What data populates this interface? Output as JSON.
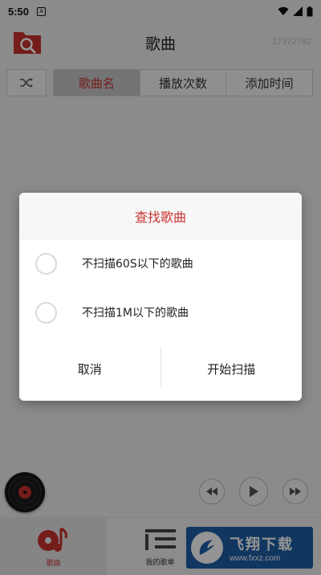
{
  "status_bar": {
    "time": "5:50",
    "notif_icon": "A"
  },
  "app_bar": {
    "title": "歌曲",
    "subtitle": "17372792",
    "logo_icon": "folder-search-icon"
  },
  "sort_tabs": [
    {
      "label": "歌曲名",
      "active": true
    },
    {
      "label": "播放次数",
      "active": false
    },
    {
      "label": "添加时间",
      "active": false
    }
  ],
  "dialog": {
    "title": "查找歌曲",
    "options": [
      {
        "label": "不扫描60S以下的歌曲",
        "checked": false
      },
      {
        "label": "不扫描1M以下的歌曲",
        "checked": false
      }
    ],
    "cancel_label": "取消",
    "confirm_label": "开始扫描"
  },
  "bottom_nav": {
    "items": [
      {
        "label": "歌曲",
        "icon": "music-note-icon",
        "active": true
      },
      {
        "label": "我的歌单",
        "icon": "playlist-icon",
        "active": false
      },
      {
        "label": "",
        "icon": "headphones-icon",
        "active": false
      }
    ]
  },
  "watermark": {
    "cn": "飞翔下载",
    "url": "www.fxxz.com"
  },
  "colors": {
    "accent": "#c8322e",
    "watermark_bg": "#1e5fa8"
  }
}
